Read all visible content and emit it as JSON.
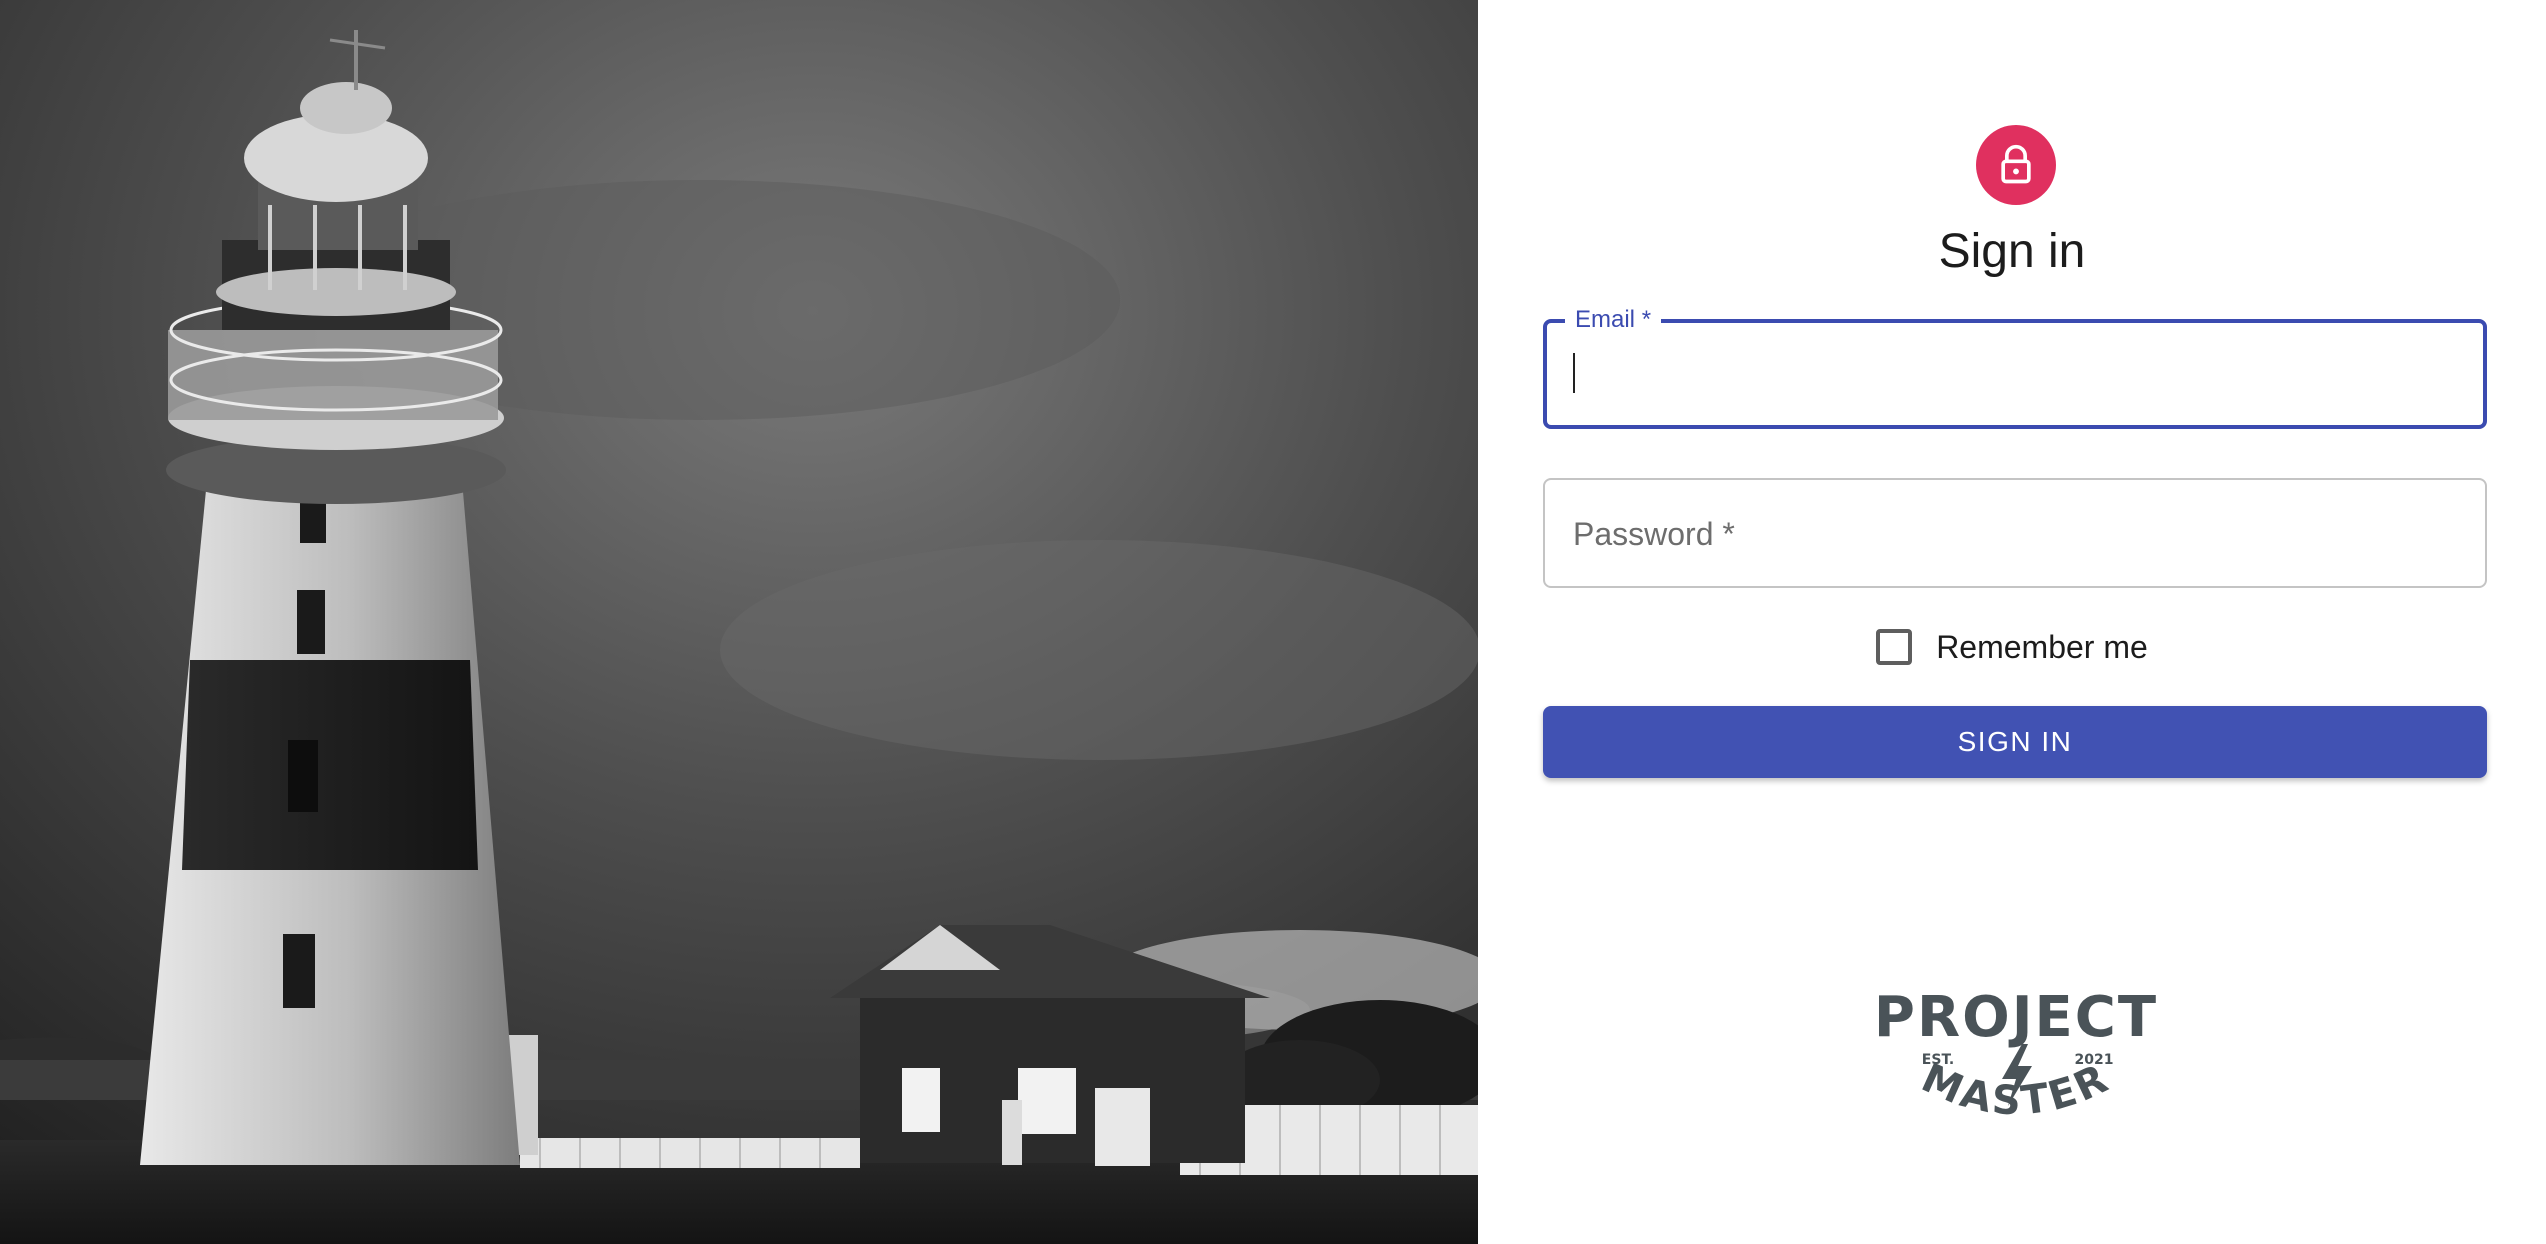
{
  "photo": {
    "icon": "lighthouse-photo"
  },
  "signin": {
    "avatar_icon": "lock-icon",
    "title": "Sign in",
    "email": {
      "label": "Email",
      "required_mark": "*",
      "value": ""
    },
    "password": {
      "placeholder": "Password",
      "required_mark": "*",
      "value": ""
    },
    "remember": {
      "label": "Remember me",
      "checked": false
    },
    "submit_label": "SIGN IN"
  },
  "logo": {
    "top": "PROJECT",
    "bottom": "MASTER",
    "est": "EST.",
    "year": "2021"
  },
  "colors": {
    "accent": "#3b4bb0",
    "button": "#4152b3",
    "avatar": "#e0305f",
    "logo": "#4a5358"
  }
}
